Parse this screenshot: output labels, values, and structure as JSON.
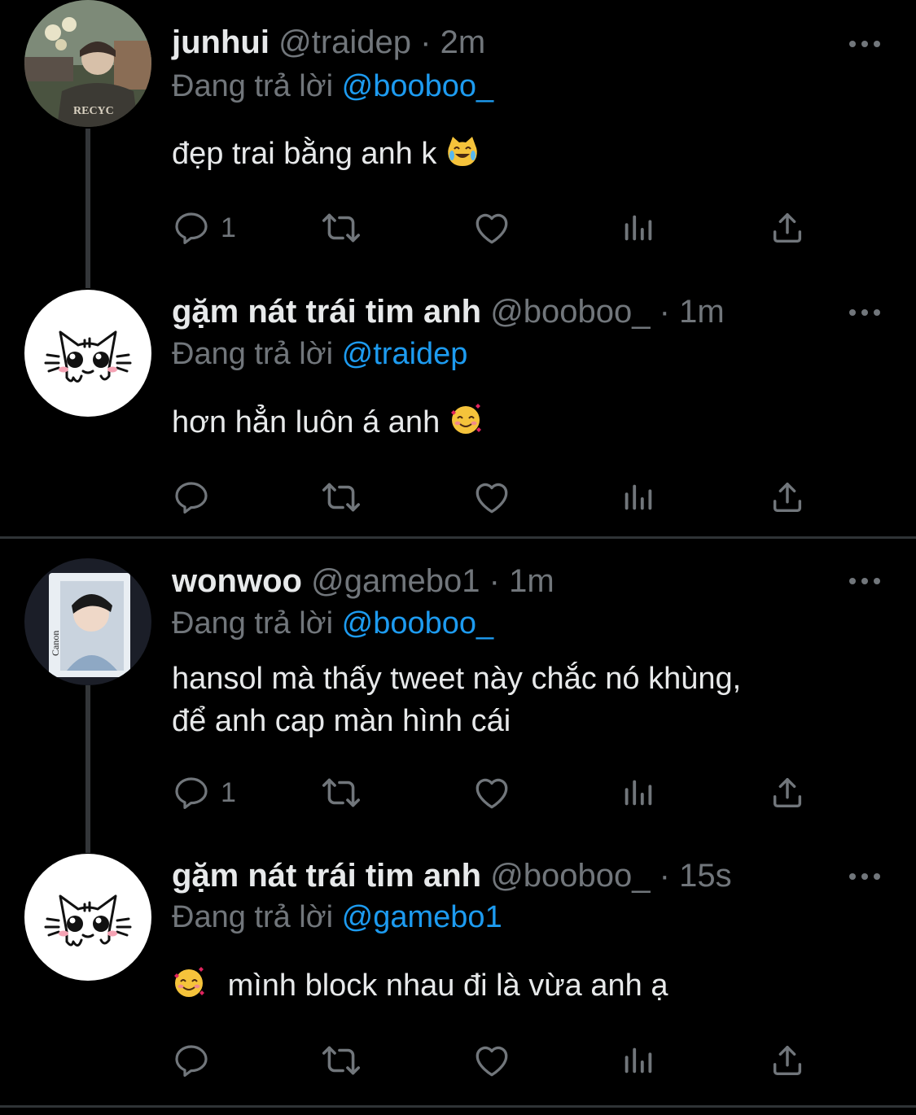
{
  "colors": {
    "background": "#000000",
    "text": "#e7e9ea",
    "muted": "#71767b",
    "mention": "#1d9bf0",
    "divider": "#2f3336"
  },
  "tweets": [
    {
      "name": "junhui",
      "handle": "@traidep",
      "dot": "·",
      "time": "2m",
      "reply_prefix": "Đang trả lời",
      "reply_to": "@booboo_",
      "text": "đẹp trai bằng anh k",
      "emoji": "crying-laughing-cat-emoji",
      "reply_count": "1",
      "avatar": "photo-person-avatar"
    },
    {
      "name": "gặm nát trái tim anh",
      "handle": "@booboo_",
      "dot": "·",
      "time": "1m",
      "reply_prefix": "Đang trả lời",
      "reply_to": "@traidep",
      "text": "hơn hẳn luôn á anh",
      "emoji": "smiling-face-with-hearts-emoji",
      "reply_count": "",
      "avatar": "cat-doodle-avatar"
    },
    {
      "name": "wonwoo",
      "handle": "@gamebo1",
      "dot": "·",
      "time": "1m",
      "reply_prefix": "Đang trả lời",
      "reply_to": "@booboo_",
      "text_line1": "hansol mà thấy tweet này chắc nó khùng,",
      "text_line2": "để anh cap màn hình cái",
      "reply_count": "1",
      "avatar": "photo-person-avatar"
    },
    {
      "name": "gặm nát trái tim anh",
      "handle": "@booboo_",
      "dot": "·",
      "time": "15s",
      "reply_prefix": "Đang trả lời",
      "reply_to": "@gamebo1",
      "text": "mình block nhau đi là vừa anh ạ",
      "emoji": "smiling-face-with-hearts-emoji",
      "reply_count": "",
      "avatar": "cat-doodle-avatar"
    }
  ],
  "icons": [
    "reply-icon",
    "retweet-icon",
    "like-icon",
    "analytics-icon",
    "share-icon",
    "more-icon"
  ]
}
